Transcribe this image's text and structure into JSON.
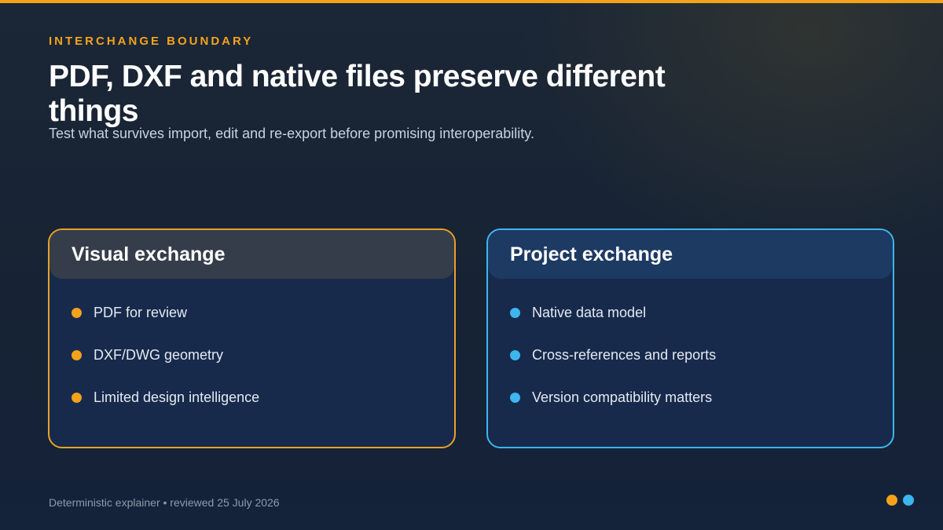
{
  "colors": {
    "accent_orange": "#f5a21b",
    "accent_blue": "#3db5ef",
    "background": "#172334"
  },
  "header": {
    "eyebrow": "INTERCHANGE BOUNDARY",
    "title": "PDF, DXF and native files preserve different things",
    "subtitle": "Test what survives import, edit and re-export before promising interoperability."
  },
  "cards": [
    {
      "title": "Visual exchange",
      "items": [
        "PDF for review",
        "DXF/DWG geometry",
        "Limited design intelligence"
      ]
    },
    {
      "title": "Project exchange",
      "items": [
        "Native data model",
        "Cross-references and reports",
        "Version compatibility matters"
      ]
    }
  ],
  "footer": {
    "text": "Deterministic explainer • reviewed 25 July 2026"
  },
  "pager": {
    "dots": [
      "orange-dot",
      "blue-dot"
    ]
  }
}
